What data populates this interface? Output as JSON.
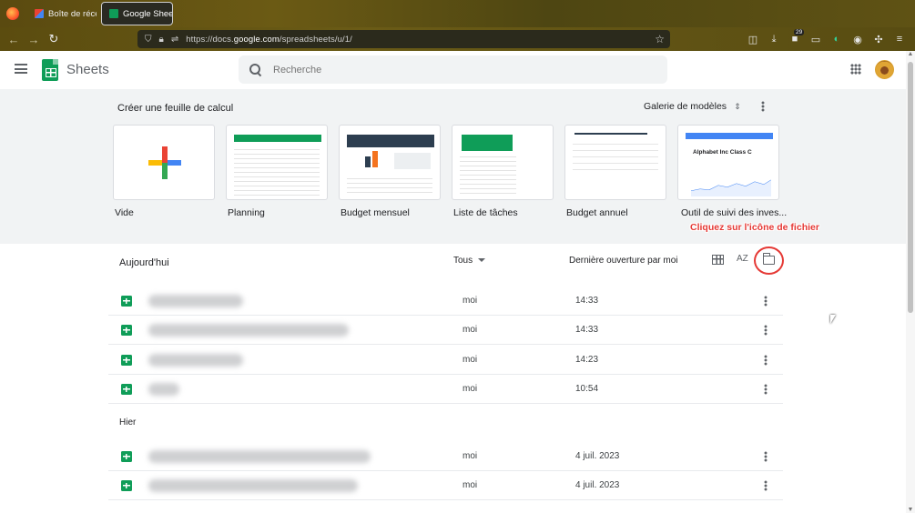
{
  "browser": {
    "tabs": [
      {
        "label": "Boîte de récep",
        "icon": "gmail-icon"
      },
      {
        "label": "Google Shee",
        "icon": "sheets-icon",
        "close": "×"
      }
    ],
    "url_prefix": "https://docs.",
    "url_domain": "google.com",
    "url_path": "/spreadsheets/u/1/",
    "badge_count": "29"
  },
  "app": {
    "name": "Sheets",
    "search_placeholder": "Recherche"
  },
  "templates": {
    "title": "Créer une feuille de calcul",
    "gallery_label": "Galerie de modèles",
    "items": [
      {
        "label": "Vide"
      },
      {
        "label": "Planning"
      },
      {
        "label": "Budget mensuel"
      },
      {
        "label": "Liste de tâches"
      },
      {
        "label": "Budget annuel"
      },
      {
        "label": "Outil de suivi des inves..."
      }
    ],
    "stock_card_title": "Alphabet Inc Class C"
  },
  "annotation": {
    "callout": "Cliquez sur l'icône de fichier"
  },
  "list": {
    "today_label": "Aujourd'hui",
    "yesterday_label": "Hier",
    "owner_filter": "Tous",
    "sort_label": "Dernière ouverture par moi",
    "az_label": "AZ",
    "today_rows": [
      {
        "owner": "moi",
        "date": "14:33"
      },
      {
        "owner": "moi",
        "date": "14:33"
      },
      {
        "owner": "moi",
        "date": "14:23"
      },
      {
        "owner": "moi",
        "date": "10:54"
      }
    ],
    "yesterday_rows": [
      {
        "owner": "moi",
        "date": "4 juil. 2023"
      },
      {
        "owner": "moi",
        "date": "4 juil. 2023"
      }
    ]
  },
  "colors": {
    "sheets_green": "#0f9d58",
    "annotation_red": "#e53935"
  }
}
